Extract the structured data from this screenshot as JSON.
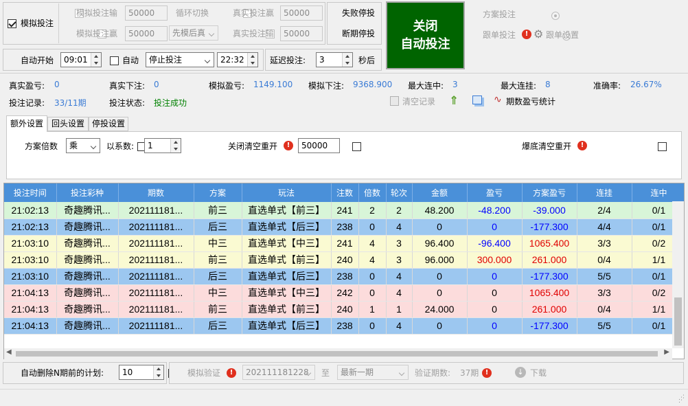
{
  "top": {
    "sim_bet_checkbox": "模拟投注",
    "sim_lose_label": "模拟投注输",
    "sim_lose_value": "50000",
    "loop_switch": "循环切换",
    "real_win_label": "真实投注赢",
    "real_win_value": "50000",
    "sim_win_label": "模拟投注赢",
    "sim_win_value": "50000",
    "loop_mode_value": "先模后真",
    "real_lose_label": "真实投注输",
    "real_lose_value": "50000",
    "fail_stop": "失败停投",
    "break_stop": "断期停投",
    "close_button_line1": "关闭",
    "close_button_line2": "自动投注",
    "radio_plan": "方案投注",
    "radio_follow": "跟单投注",
    "follow_settings": "跟单设置"
  },
  "schedule": {
    "auto_start": "自动开始",
    "start_time": "09:01",
    "auto": "自动",
    "action_value": "停止投注",
    "end_time": "22:32",
    "delay_label": "延迟投注:",
    "delay_value": "3",
    "delay_unit": "秒后"
  },
  "stats": {
    "real_pl_label": "真实盈亏:",
    "real_pl_value": "0",
    "real_bet_label": "真实下注:",
    "real_bet_value": "0",
    "sim_pl_label": "模拟盈亏:",
    "sim_pl_value": "1149.100",
    "sim_bet_label": "模拟下注:",
    "sim_bet_value": "9368.900",
    "max_win_label": "最大连中:",
    "max_win_value": "3",
    "max_lose_label": "最大连挂:",
    "max_lose_value": "8",
    "accuracy_label": "准确率:",
    "accuracy_value": "26.67%",
    "record_label": "投注记录:",
    "record_value": "33/11期",
    "status_label": "投注状态:",
    "status_value": "投注成功",
    "clear_record": "清空记录",
    "period_stats": "期数盈亏统计"
  },
  "tabs": [
    "额外设置",
    "回头设置",
    "停投设置"
  ],
  "extra": {
    "plan_multiplier": "方案倍数",
    "op_value": "乘",
    "coef_label": "以系数:",
    "coef_value": "1",
    "close_clear_restart": "关闭清空重开",
    "close_clear_value": "50000",
    "bust_clear_restart": "爆底清空重开"
  },
  "table": {
    "headers": [
      "投注时间",
      "投注彩种",
      "期数",
      "方案",
      "玩法",
      "注数",
      "倍数",
      "轮次",
      "金额",
      "盈亏",
      "方案盈亏",
      "连挂",
      "连中"
    ],
    "rows": [
      {
        "time": "21:02:13",
        "lottery": "奇趣腾讯...",
        "period": "202111181...",
        "plan": "前三",
        "play": "直选单式【前三】",
        "count": "241",
        "mult": "2",
        "round": "2",
        "amount": "48.200",
        "pl": "-48.200",
        "plan_pl": "-39.000",
        "lose": "2/4",
        "win": "0/1",
        "bg": "#d8f5d8",
        "pl_c": "neg",
        "plan_pl_c": "neg"
      },
      {
        "time": "21:02:13",
        "lottery": "奇趣腾讯...",
        "period": "202111181...",
        "plan": "后三",
        "play": "直选单式【后三】",
        "count": "238",
        "mult": "0",
        "round": "4",
        "amount": "0",
        "pl": "0",
        "plan_pl": "-177.300",
        "lose": "4/4",
        "win": "0/1",
        "bg": "#9cc7f0",
        "pl_c": "neg",
        "plan_pl_c": "neg"
      },
      {
        "time": "21:03:10",
        "lottery": "奇趣腾讯...",
        "period": "202111181...",
        "plan": "中三",
        "play": "直选单式【中三】",
        "count": "241",
        "mult": "4",
        "round": "3",
        "amount": "96.400",
        "pl": "-96.400",
        "plan_pl": "1065.400",
        "lose": "3/3",
        "win": "0/2",
        "bg": "#fafad2",
        "pl_c": "neg",
        "plan_pl_c": "pos"
      },
      {
        "time": "21:03:10",
        "lottery": "奇趣腾讯...",
        "period": "202111181...",
        "plan": "前三",
        "play": "直选单式【前三】",
        "count": "240",
        "mult": "4",
        "round": "3",
        "amount": "96.000",
        "pl": "300.000",
        "plan_pl": "261.000",
        "lose": "0/4",
        "win": "1/1",
        "bg": "#fafad2",
        "pl_c": "pos",
        "plan_pl_c": "pos"
      },
      {
        "time": "21:03:10",
        "lottery": "奇趣腾讯...",
        "period": "202111181...",
        "plan": "后三",
        "play": "直选单式【后三】",
        "count": "238",
        "mult": "0",
        "round": "4",
        "amount": "0",
        "pl": "0",
        "plan_pl": "-177.300",
        "lose": "5/5",
        "win": "0/1",
        "bg": "#9cc7f0",
        "pl_c": "neg",
        "plan_pl_c": "neg"
      },
      {
        "time": "21:04:13",
        "lottery": "奇趣腾讯...",
        "period": "202111181...",
        "plan": "中三",
        "play": "直选单式【中三】",
        "count": "242",
        "mult": "0",
        "round": "4",
        "amount": "0",
        "pl": "0",
        "plan_pl": "1065.400",
        "lose": "3/3",
        "win": "0/2",
        "bg": "#fcdcdc",
        "pl_c": "",
        "plan_pl_c": "pos"
      },
      {
        "time": "21:04:13",
        "lottery": "奇趣腾讯...",
        "period": "202111181...",
        "plan": "前三",
        "play": "直选单式【前三】",
        "count": "240",
        "mult": "1",
        "round": "1",
        "amount": "24.000",
        "pl": "0",
        "plan_pl": "261.000",
        "lose": "0/4",
        "win": "1/1",
        "bg": "#fcdcdc",
        "pl_c": "",
        "plan_pl_c": "pos"
      },
      {
        "time": "21:04:13",
        "lottery": "奇趣腾讯...",
        "period": "202111181...",
        "plan": "后三",
        "play": "直选单式【后三】",
        "count": "238",
        "mult": "0",
        "round": "4",
        "amount": "0",
        "pl": "0",
        "plan_pl": "-177.300",
        "lose": "5/5",
        "win": "0/1",
        "bg": "#9cc7f0",
        "pl_c": "neg",
        "plan_pl_c": "neg"
      }
    ]
  },
  "bottom": {
    "auto_delete": "自动删除N期前的计划:",
    "auto_delete_value": "10",
    "sim_verify": "模拟验证",
    "from_period": "2021111812​28",
    "to_label": "至",
    "to_value": "最新一期",
    "verify_count_label": "验证期数:",
    "verify_count_value": "37期",
    "download": "下载"
  },
  "colors": {
    "header_blue": "#4a90d9",
    "close_green": "#006400",
    "neg": "#0000ff",
    "pos": "#e00000",
    "stat_blue": "#3a7bd5",
    "status_green": "#008000"
  }
}
